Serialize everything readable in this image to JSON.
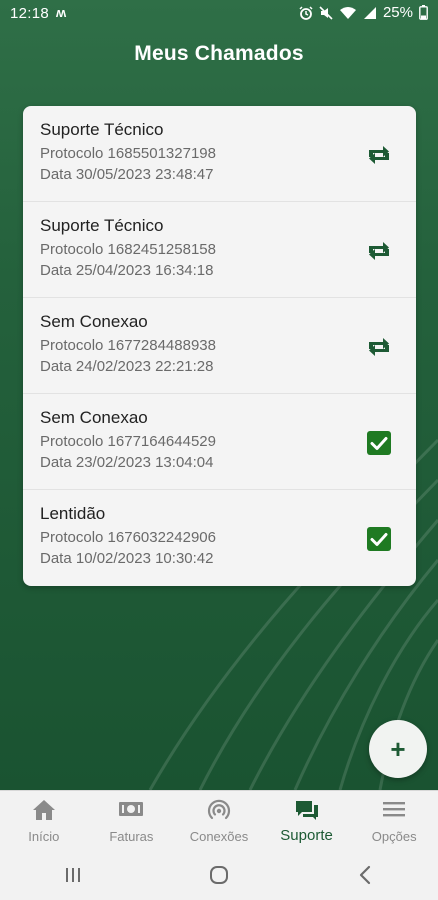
{
  "status_bar": {
    "time": "12:18",
    "carrier_glyph": "ʍ",
    "battery": "25%",
    "icons": [
      "alarm-icon",
      "mute-icon",
      "wifi-icon",
      "signal-icon",
      "battery-icon"
    ]
  },
  "page": {
    "title": "Meus Chamados"
  },
  "tickets": [
    {
      "name": "Suporte Técnico",
      "protocol": "Protocolo 1685501327198",
      "date": "Data 30/05/2023 23:48:47",
      "status_icon": "repeat-icon"
    },
    {
      "name": "Suporte Técnico",
      "protocol": "Protocolo 1682451258158",
      "date": "Data 25/04/2023 16:34:18",
      "status_icon": "repeat-icon"
    },
    {
      "name": "Sem Conexao",
      "protocol": "Protocolo 1677284488938",
      "date": "Data 24/02/2023 22:21:28",
      "status_icon": "repeat-icon"
    },
    {
      "name": "Sem Conexao",
      "protocol": "Protocolo 1677164644529",
      "date": "Data 23/02/2023 13:04:04",
      "status_icon": "check-icon"
    },
    {
      "name": "Lentidão",
      "protocol": "Protocolo 1676032242906",
      "date": "Data 10/02/2023 10:30:42",
      "status_icon": "check-icon"
    }
  ],
  "fab": {
    "label": "+"
  },
  "bottom_nav": {
    "items": [
      {
        "label": "Início",
        "icon": "home-icon"
      },
      {
        "label": "Faturas",
        "icon": "money-icon"
      },
      {
        "label": "Conexões",
        "icon": "broadcast-icon"
      },
      {
        "label": "Suporte",
        "icon": "chat-icon"
      },
      {
        "label": "Opções",
        "icon": "menu-icon"
      }
    ],
    "active": "Suporte"
  },
  "colors": {
    "brand_green": "#1d5a34",
    "background_green": "#24613c",
    "card": "#f4f4f4",
    "inactive": "#8a8a8a"
  }
}
